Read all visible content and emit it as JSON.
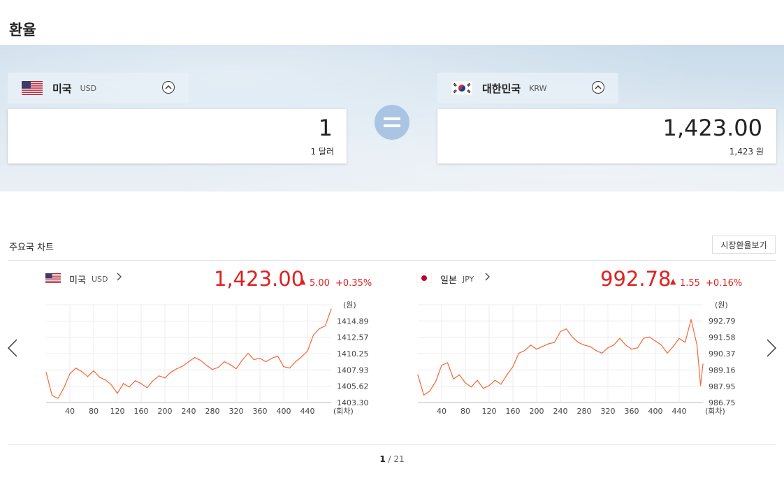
{
  "page": {
    "title": "환율"
  },
  "converter": {
    "from": {
      "name": "미국",
      "code": "USD",
      "amount": "1",
      "amount_text": "1 달러"
    },
    "to": {
      "name": "대한민국",
      "code": "KRW",
      "amount": "1,423.00",
      "amount_text": "1,423 원"
    }
  },
  "charts_section": {
    "title": "주요국 차트",
    "market_button": "시장환율보기",
    "pager": {
      "current": "1",
      "total": "/ 21"
    }
  },
  "chart_data": [
    {
      "type": "line",
      "currency_name": "미국",
      "currency_code": "USD",
      "price": "1,423.00",
      "change": "5.00",
      "change_pct": "+0.35%",
      "y_unit": "(원)",
      "x_unit": "(회차)",
      "y_ticks": [
        "1414.89",
        "1412.57",
        "1410.25",
        "1407.93",
        "1405.62",
        "1403.30"
      ],
      "x_ticks": [
        "40",
        "80",
        "120",
        "160",
        "200",
        "240",
        "280",
        "320",
        "360",
        "400",
        "440"
      ],
      "ylim": [
        1403.3,
        1417.21
      ],
      "xlim": [
        0,
        480
      ],
      "color": "#f4673a",
      "x": [
        0,
        10,
        20,
        30,
        40,
        50,
        60,
        70,
        80,
        90,
        100,
        110,
        120,
        130,
        140,
        150,
        160,
        170,
        180,
        190,
        200,
        210,
        220,
        230,
        240,
        250,
        260,
        270,
        280,
        290,
        300,
        310,
        320,
        330,
        340,
        350,
        360,
        370,
        380,
        390,
        400,
        410,
        420,
        430,
        440,
        450,
        460,
        470,
        480
      ],
      "values": [
        1407.6,
        1404.3,
        1403.9,
        1405.4,
        1407.4,
        1408.2,
        1407.7,
        1407.0,
        1407.8,
        1406.9,
        1406.5,
        1405.8,
        1404.6,
        1406.0,
        1405.5,
        1406.4,
        1406.0,
        1405.4,
        1406.4,
        1407.1,
        1406.8,
        1407.6,
        1408.1,
        1408.5,
        1409.1,
        1409.7,
        1409.3,
        1408.6,
        1408.0,
        1408.3,
        1409.1,
        1408.7,
        1408.1,
        1409.3,
        1410.3,
        1409.4,
        1409.6,
        1409.1,
        1409.6,
        1409.9,
        1408.4,
        1408.2,
        1409.1,
        1409.8,
        1410.6,
        1412.9,
        1413.8,
        1414.2,
        1416.6
      ]
    },
    {
      "type": "line",
      "currency_name": "일본",
      "currency_code": "JPY",
      "price": "992.78",
      "change": "1.55",
      "change_pct": "+0.16%",
      "y_unit": "(원)",
      "x_unit": "(회차)",
      "y_ticks": [
        "992.79",
        "991.58",
        "990.37",
        "989.16",
        "987.95",
        "986.75"
      ],
      "x_ticks": [
        "40",
        "80",
        "120",
        "160",
        "200",
        "240",
        "280",
        "320",
        "360",
        "400",
        "440"
      ],
      "ylim": [
        986.75,
        993.99
      ],
      "xlim": [
        0,
        480
      ],
      "color": "#f4673a",
      "x": [
        0,
        10,
        20,
        30,
        40,
        50,
        60,
        70,
        80,
        90,
        100,
        110,
        120,
        130,
        140,
        150,
        160,
        170,
        180,
        190,
        200,
        210,
        220,
        230,
        240,
        250,
        260,
        270,
        280,
        290,
        300,
        310,
        320,
        330,
        340,
        350,
        360,
        370,
        380,
        390,
        400,
        410,
        420,
        430,
        440,
        450,
        460,
        470,
        476,
        480
      ],
      "values": [
        988.8,
        987.3,
        987.6,
        988.3,
        989.5,
        989.7,
        988.5,
        988.8,
        988.2,
        987.9,
        988.4,
        987.8,
        988.0,
        988.4,
        988.1,
        988.8,
        989.4,
        990.4,
        990.6,
        991.0,
        990.7,
        990.9,
        991.1,
        991.2,
        992.0,
        992.2,
        991.6,
        991.2,
        991.0,
        990.9,
        990.6,
        990.4,
        990.8,
        991.0,
        991.5,
        991.0,
        990.7,
        990.8,
        991.5,
        991.6,
        991.3,
        991.0,
        990.4,
        990.9,
        991.5,
        991.2,
        992.9,
        991.0,
        988.0,
        989.6
      ]
    }
  ]
}
